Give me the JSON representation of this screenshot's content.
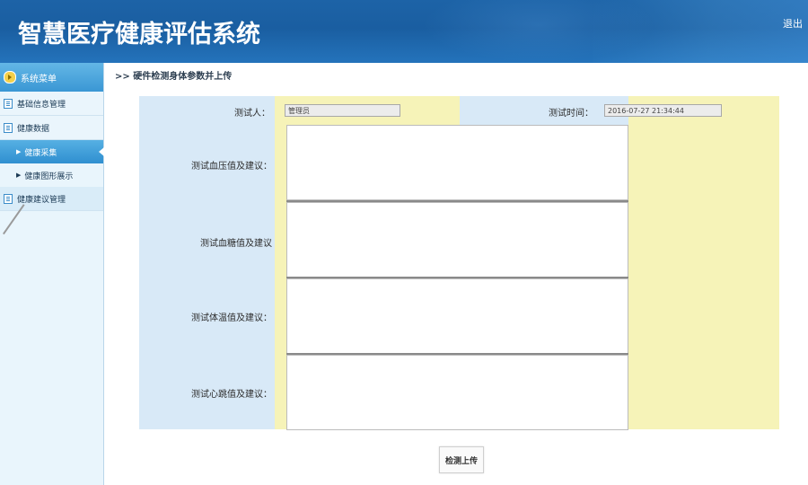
{
  "header": {
    "app_title": "智慧医疗健康评估系统",
    "logout_label": "退出"
  },
  "sidebar": {
    "menu_title": "系统菜单",
    "groups": [
      {
        "label": "基础信息管理"
      },
      {
        "label": "健康数据",
        "items": [
          {
            "label": "健康采集",
            "active": true
          },
          {
            "label": "健康图形展示",
            "active": false
          }
        ]
      },
      {
        "label": "健康建议管理"
      }
    ]
  },
  "breadcrumb": ">> 硬件检测身体参数并上传",
  "form": {
    "tester_label": "测试人：",
    "tester_value": "管理员",
    "time_label": "测试时间：",
    "time_value": "2016-07-27 21:34:44",
    "fields": [
      {
        "label": "测试血压值及建议：",
        "value": ""
      },
      {
        "label": "测试血糖值及建议",
        "value": ""
      },
      {
        "label": "测试体温值及建议：",
        "value": ""
      },
      {
        "label": "测试心跳值及建议：",
        "value": ""
      }
    ],
    "submit_label": "检测上传"
  },
  "colors": {
    "header_blue": "#1d63a7",
    "label_bg": "#d8e9f7",
    "field_bg": "#f6f3b8",
    "active_menu": "#2f8fd0"
  }
}
